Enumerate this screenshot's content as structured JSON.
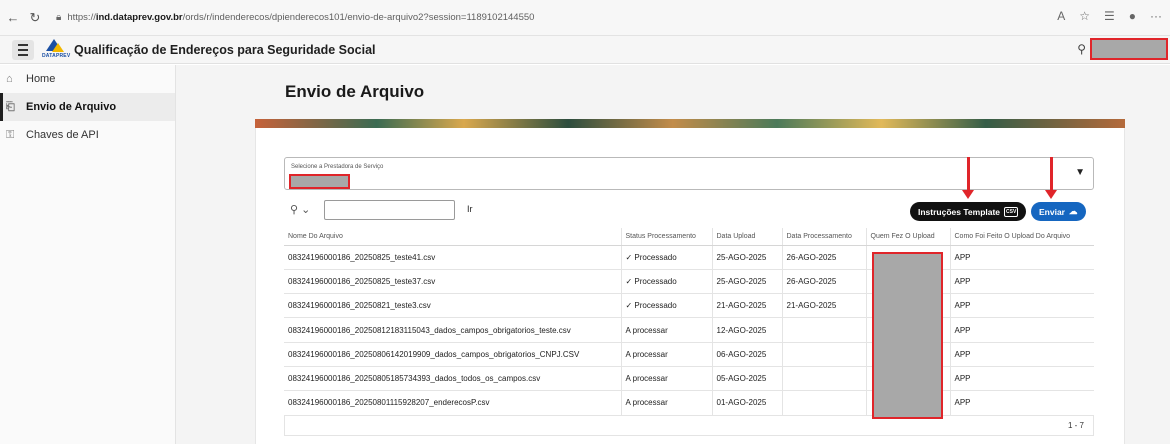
{
  "browser": {
    "url_prefix": "https://",
    "url_domain": "ind.dataprev.gov.br",
    "url_path": "/ords/r/indenderecos/dpienderecos101/envio-de-arquivo2?session=1189102144550"
  },
  "header": {
    "logo_text": "DATAPREV",
    "title": "Qualificação de Endereços para Seguridade Social"
  },
  "sidebar": {
    "items": [
      {
        "label": "Home"
      },
      {
        "label": "Envio de Arquivo"
      },
      {
        "label": "Chaves de API"
      }
    ]
  },
  "page": {
    "title": "Envio de Arquivo"
  },
  "select": {
    "label": "Selecione a Prestadora de Serviço"
  },
  "toolbar": {
    "go_label": "Ir",
    "instructions_label": "Instruções Template",
    "csv_label": "CSV",
    "send_label": "Enviar"
  },
  "table": {
    "columns": [
      "Nome Do Arquivo",
      "Status Processamento",
      "Data Upload",
      "Data Processamento",
      "Quem Fez O Upload",
      "Como Foi Feito O Upload Do Arquivo"
    ],
    "rows": [
      {
        "name": "08324196000186_20250825_teste41.csv",
        "status": "✓ Processado",
        "upload": "25-AGO-2025",
        "processed": "26-AGO-2025",
        "who": "",
        "how": "APP"
      },
      {
        "name": "08324196000186_20250825_teste37.csv",
        "status": "✓ Processado",
        "upload": "25-AGO-2025",
        "processed": "26-AGO-2025",
        "who": "",
        "how": "APP"
      },
      {
        "name": "08324196000186_20250821_teste3.csv",
        "status": "✓ Processado",
        "upload": "21-AGO-2025",
        "processed": "21-AGO-2025",
        "who": "",
        "how": "APP"
      },
      {
        "name": "08324196000186_20250812183115043_dados_campos_obrigatorios_teste.csv",
        "status": "A processar",
        "upload": "12-AGO-2025",
        "processed": "",
        "who": "",
        "how": "APP"
      },
      {
        "name": "08324196000186_20250806142019909_dados_campos_obrigatorios_CNPJ.CSV",
        "status": "A processar",
        "upload": "06-AGO-2025",
        "processed": "",
        "who": "",
        "how": "APP"
      },
      {
        "name": "08324196000186_20250805185734393_dados_todos_os_campos.csv",
        "status": "A processar",
        "upload": "05-AGO-2025",
        "processed": "",
        "who": "",
        "how": "APP"
      },
      {
        "name": "08324196000186_20250801115928207_enderecosP.csv",
        "status": "A processar",
        "upload": "01-AGO-2025",
        "processed": "",
        "who": "",
        "how": "APP"
      }
    ]
  },
  "pagination": {
    "range": "1 - 7"
  }
}
